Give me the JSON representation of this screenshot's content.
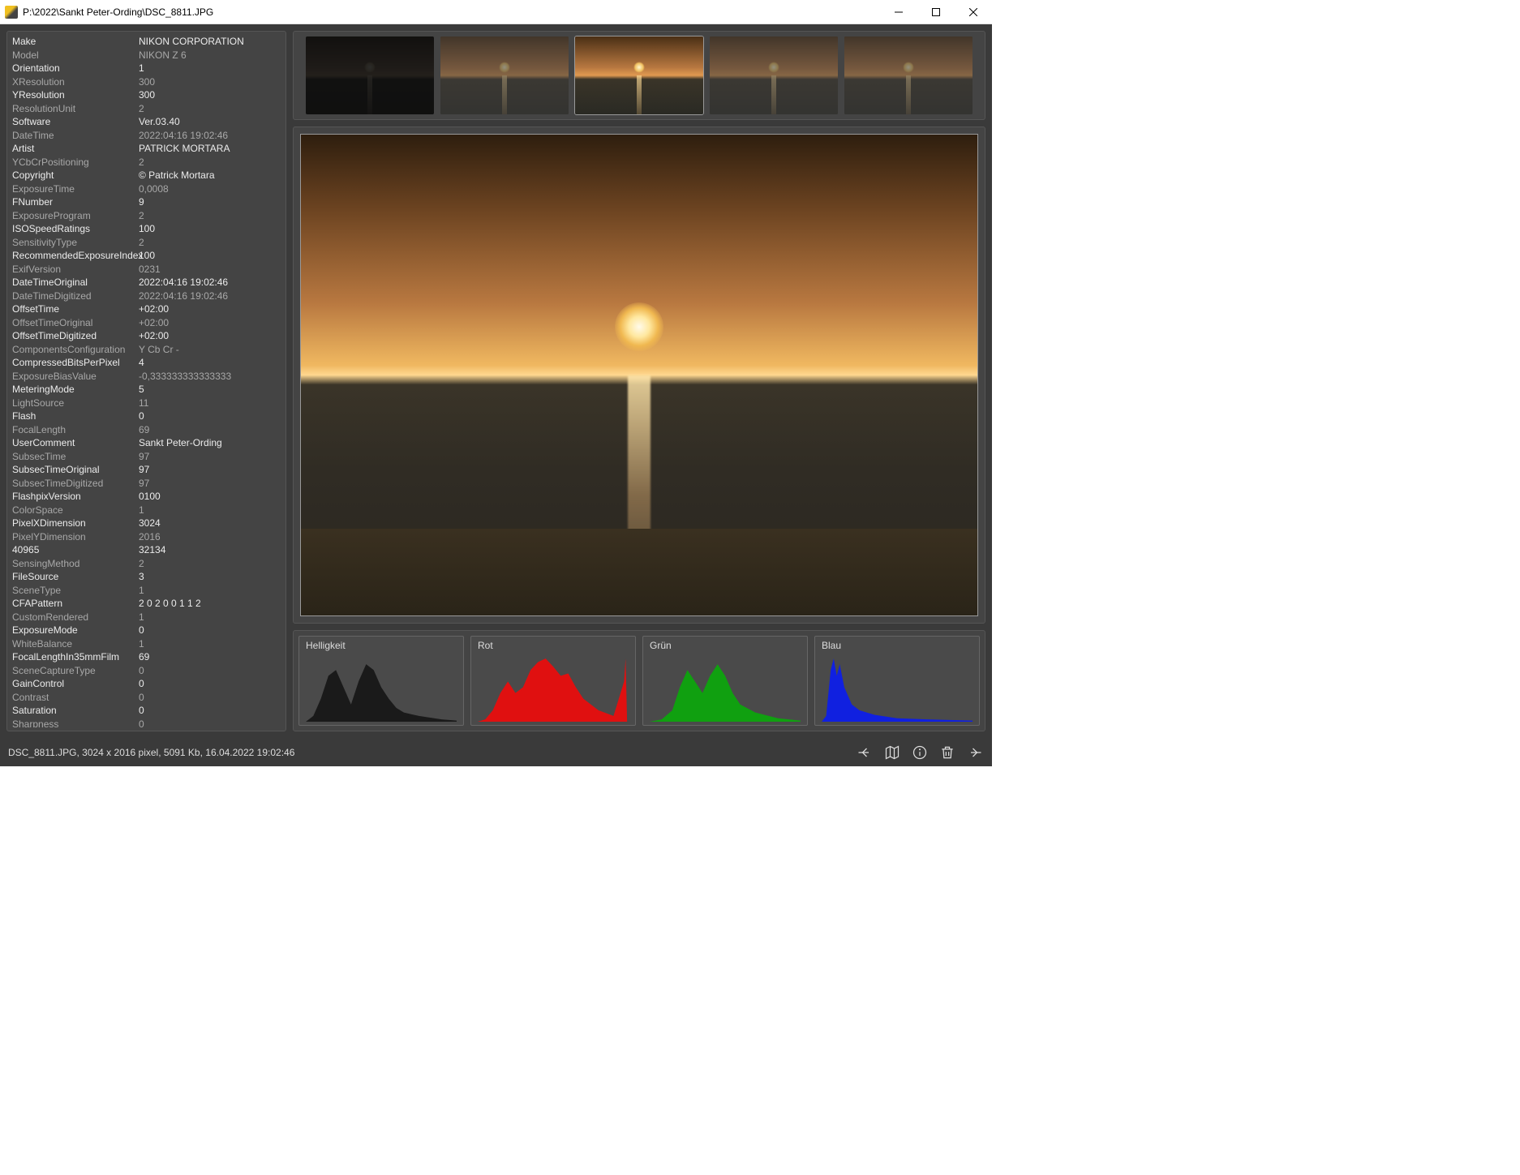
{
  "window": {
    "title": "P:\\2022\\Sankt Peter-Ording\\DSC_8811.JPG"
  },
  "exif": [
    {
      "k": "Make",
      "v": "NIKON CORPORATION",
      "b": 1
    },
    {
      "k": "Model",
      "v": "NIKON Z 6",
      "b": 0
    },
    {
      "k": "Orientation",
      "v": "1",
      "b": 1
    },
    {
      "k": "XResolution",
      "v": "300",
      "b": 0
    },
    {
      "k": "YResolution",
      "v": "300",
      "b": 1
    },
    {
      "k": "ResolutionUnit",
      "v": "2",
      "b": 0
    },
    {
      "k": "Software",
      "v": "Ver.03.40",
      "b": 1
    },
    {
      "k": "DateTime",
      "v": "2022:04:16 19:02:46",
      "b": 0
    },
    {
      "k": "Artist",
      "v": "PATRICK MORTARA",
      "b": 1
    },
    {
      "k": "YCbCrPositioning",
      "v": "2",
      "b": 0
    },
    {
      "k": "Copyright",
      "v": "© Patrick Mortara",
      "b": 1
    },
    {
      "k": "ExposureTime",
      "v": "0,0008",
      "b": 0
    },
    {
      "k": "FNumber",
      "v": "9",
      "b": 1
    },
    {
      "k": "ExposureProgram",
      "v": "2",
      "b": 0
    },
    {
      "k": "ISOSpeedRatings",
      "v": "100",
      "b": 1
    },
    {
      "k": "SensitivityType",
      "v": "2",
      "b": 0
    },
    {
      "k": "RecommendedExposureIndex",
      "v": "100",
      "b": 1
    },
    {
      "k": "ExifVersion",
      "v": "0231",
      "b": 0
    },
    {
      "k": "DateTimeOriginal",
      "v": "2022:04:16 19:02:46",
      "b": 1
    },
    {
      "k": "DateTimeDigitized",
      "v": "2022:04:16 19:02:46",
      "b": 0
    },
    {
      "k": "OffsetTime",
      "v": "+02:00",
      "b": 1
    },
    {
      "k": "OffsetTimeOriginal",
      "v": "+02:00",
      "b": 0
    },
    {
      "k": "OffsetTimeDigitized",
      "v": "+02:00",
      "b": 1
    },
    {
      "k": "ComponentsConfiguration",
      "v": "Y Cb Cr -",
      "b": 0
    },
    {
      "k": "CompressedBitsPerPixel",
      "v": "4",
      "b": 1
    },
    {
      "k": "ExposureBiasValue",
      "v": "-0,333333333333333",
      "b": 0
    },
    {
      "k": "MeteringMode",
      "v": "5",
      "b": 1
    },
    {
      "k": "LightSource",
      "v": "11",
      "b": 0
    },
    {
      "k": "Flash",
      "v": "0",
      "b": 1
    },
    {
      "k": "FocalLength",
      "v": "69",
      "b": 0
    },
    {
      "k": "UserComment",
      "v": "Sankt Peter-Ording",
      "b": 1
    },
    {
      "k": "SubsecTime",
      "v": "97",
      "b": 0
    },
    {
      "k": "SubsecTimeOriginal",
      "v": "97",
      "b": 1
    },
    {
      "k": "SubsecTimeDigitized",
      "v": "97",
      "b": 0
    },
    {
      "k": "FlashpixVersion",
      "v": "0100",
      "b": 1
    },
    {
      "k": "ColorSpace",
      "v": "1",
      "b": 0
    },
    {
      "k": "PixelXDimension",
      "v": "3024",
      "b": 1
    },
    {
      "k": "PixelYDimension",
      "v": "2016",
      "b": 0
    },
    {
      "k": "40965",
      "v": "32134",
      "b": 1
    },
    {
      "k": "SensingMethod",
      "v": "2",
      "b": 0
    },
    {
      "k": "FileSource",
      "v": "3",
      "b": 1
    },
    {
      "k": "SceneType",
      "v": "1",
      "b": 0
    },
    {
      "k": "CFAPattern",
      "v": "2 0 2 0 0 1 1 2",
      "b": 1
    },
    {
      "k": "CustomRendered",
      "v": "1",
      "b": 0
    },
    {
      "k": "ExposureMode",
      "v": "0",
      "b": 1
    },
    {
      "k": "WhiteBalance",
      "v": "1",
      "b": 0
    },
    {
      "k": "FocalLengthIn35mmFilm",
      "v": "69",
      "b": 1
    },
    {
      "k": "SceneCaptureType",
      "v": "0",
      "b": 0
    },
    {
      "k": "GainControl",
      "v": "0",
      "b": 1
    },
    {
      "k": "Contrast",
      "v": "0",
      "b": 0
    },
    {
      "k": "Saturation",
      "v": "0",
      "b": 1
    },
    {
      "k": "Sharpness",
      "v": "0",
      "b": 0
    }
  ],
  "histograms": {
    "brightness": "Helligkeit",
    "red": "Rot",
    "green": "Grün",
    "blue": "Blau"
  },
  "status": {
    "text": "DSC_8811.JPG, 3024 x 2016 pixel, 5091 Kb, 16.04.2022 19:02:46"
  }
}
